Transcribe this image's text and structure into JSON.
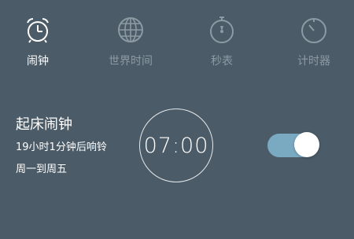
{
  "tabs": [
    {
      "label": "闹钟",
      "icon": "alarm-clock-icon",
      "active": true
    },
    {
      "label": "世界时间",
      "icon": "globe-icon",
      "active": false
    },
    {
      "label": "秒表",
      "icon": "stopwatch-icon",
      "active": false
    },
    {
      "label": "计时器",
      "icon": "timer-icon",
      "active": false
    }
  ],
  "alarm": {
    "title": "起床闹钟",
    "countdown": "19小时1分钟后响铃",
    "repeat": "周一到周五",
    "time": "07:00",
    "enabled": true
  },
  "colors": {
    "background": "#4b5b67",
    "active_text": "#ffffff",
    "inactive_text": "#8c9aa4",
    "switch_track": "#7aa9c2"
  }
}
